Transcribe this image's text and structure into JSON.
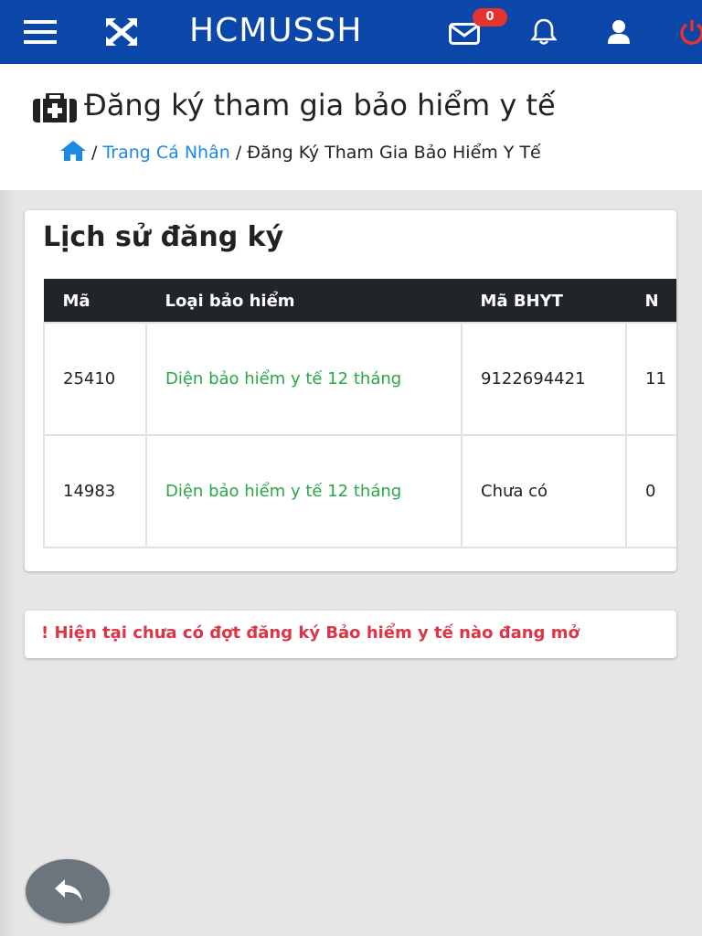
{
  "navbar": {
    "brand": "HCMUSSH",
    "mail_badge": "0",
    "icons": [
      "menu-icon",
      "expand-icon",
      "mail-icon",
      "bell-icon",
      "user-icon",
      "power-icon"
    ],
    "colors": {
      "background": "#0b47a8",
      "badge": "#e3342f",
      "power": "#e3342f"
    }
  },
  "header": {
    "title": "Đăng ký tham gia bảo hiểm y tế",
    "title_icon": "medkit-icon",
    "breadcrumb": {
      "home_icon": "home-icon",
      "separator": "/",
      "link": "Trang Cá Nhân",
      "current": "Đăng Ký Tham Gia Bảo Hiểm Y Tế"
    }
  },
  "history": {
    "title": "Lịch sử đăng ký",
    "columns": [
      "Mã",
      "Loại bảo hiểm",
      "Mã BHYT",
      "N"
    ],
    "rows": [
      {
        "ma": "25410",
        "loai": "Diện bảo hiểm y tế 12 tháng",
        "ma_bhyt": "9122694421",
        "next": "11"
      },
      {
        "ma": "14983",
        "loai": "Diện bảo hiểm y tế 12 tháng",
        "ma_bhyt": "Chưa có",
        "next": "0"
      }
    ]
  },
  "alert": {
    "icon": "!",
    "text": "Hiện tại chưa có đợt đăng ký Bảo hiểm y tế nào đang mở"
  },
  "back_button": {
    "icon": "reply-icon"
  }
}
